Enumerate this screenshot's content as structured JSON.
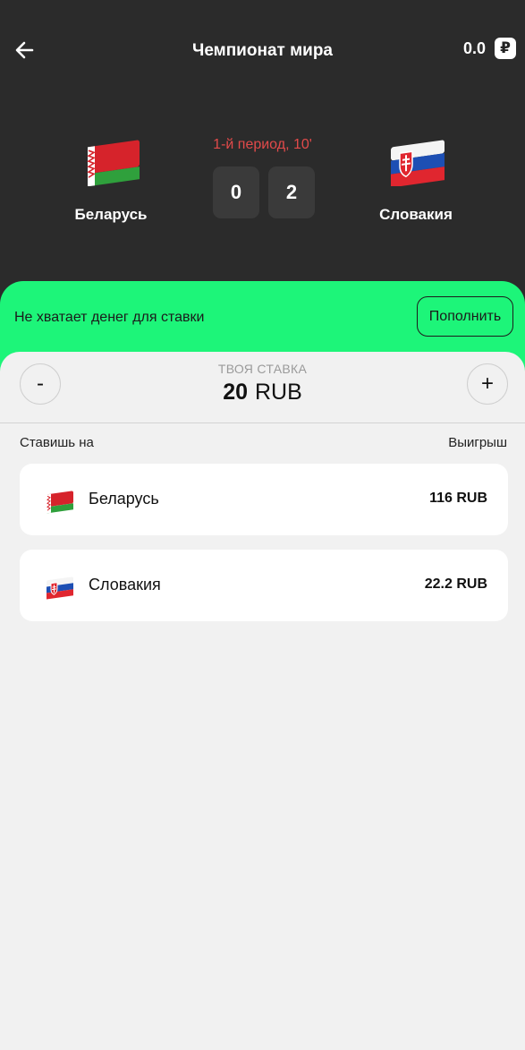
{
  "header": {
    "title": "Чемпионат мира",
    "balance": "0.0",
    "currency_symbol": "₽"
  },
  "match": {
    "period": "1-й период, 10'",
    "home": {
      "name": "Беларусь",
      "score": "0"
    },
    "away": {
      "name": "Словакия",
      "score": "2"
    }
  },
  "alert": {
    "text": "Не хватает денег для ставки",
    "button": "Пополнить"
  },
  "stake": {
    "label": "ТВОЯ СТАВКА",
    "amount": "20",
    "currency": "RUB",
    "minus": "-",
    "plus": "+"
  },
  "bets": {
    "col_left": "Ставишь на",
    "col_right": "Выигрыш",
    "items": [
      {
        "team": "Беларусь",
        "win": "116 RUB",
        "flag": "belarus-flag-icon"
      },
      {
        "team": "Словакия",
        "win": "22.2 RUB",
        "flag": "slovakia-flag-icon"
      }
    ]
  },
  "colors": {
    "accent": "#1df579",
    "dark_bg": "#2b2b2b",
    "period": "#e24a4a"
  }
}
